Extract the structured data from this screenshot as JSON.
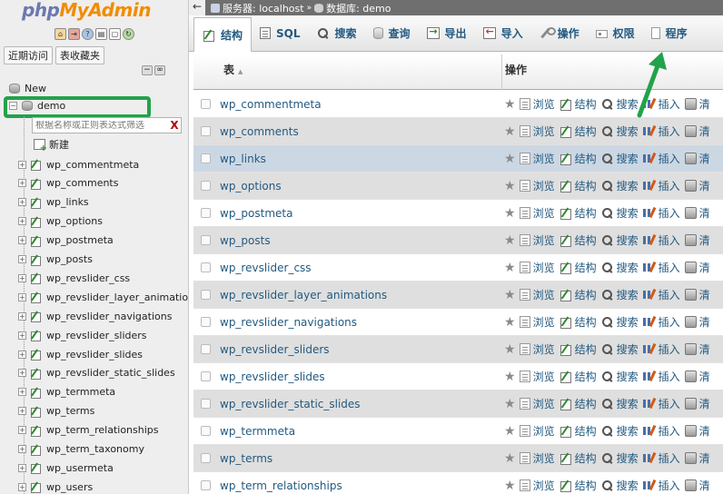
{
  "sidebar": {
    "logo_php": "php",
    "logo_myadmin": "MyAdmin",
    "quick_icons": [
      "home-icon",
      "exit-icon",
      "help-icon",
      "docs-icon",
      "reload-icon"
    ],
    "recent_label": "近期访问",
    "favorites_label": "表收藏夹",
    "new_db_label": "New",
    "db_name": "demo",
    "filter_placeholder": "根据名称或正则表达式筛选",
    "filter_clear": "X",
    "new_table_label": "新建",
    "tables": [
      "wp_commentmeta",
      "wp_comments",
      "wp_links",
      "wp_options",
      "wp_postmeta",
      "wp_posts",
      "wp_revslider_css",
      "wp_revslider_layer_animations",
      "wp_revslider_navigations",
      "wp_revslider_sliders",
      "wp_revslider_slides",
      "wp_revslider_static_slides",
      "wp_termmeta",
      "wp_terms",
      "wp_term_relationships",
      "wp_term_taxonomy",
      "wp_usermeta",
      "wp_users"
    ]
  },
  "breadcrumb": {
    "back": "←",
    "server_label": "服务器: localhost",
    "sep": "»",
    "db_label": "数据库: demo"
  },
  "tabs": [
    {
      "label": "结构",
      "icon": "structure",
      "active": true
    },
    {
      "label": "SQL",
      "icon": "sql"
    },
    {
      "label": "搜索",
      "icon": "search"
    },
    {
      "label": "查询",
      "icon": "query"
    },
    {
      "label": "导出",
      "icon": "export"
    },
    {
      "label": "导入",
      "icon": "import"
    },
    {
      "label": "操作",
      "icon": "ops"
    },
    {
      "label": "权限",
      "icon": "priv"
    },
    {
      "label": "程序",
      "icon": "routine"
    }
  ],
  "table_header": {
    "table": "表",
    "actions": "操作",
    "sort": "▲"
  },
  "actions": {
    "browse": "浏览",
    "structure": "结构",
    "search": "搜索",
    "insert": "插入",
    "empty": "清"
  },
  "rows": [
    "wp_commentmeta",
    "wp_comments",
    "wp_links",
    "wp_options",
    "wp_postmeta",
    "wp_posts",
    "wp_revslider_css",
    "wp_revslider_layer_animations",
    "wp_revslider_navigations",
    "wp_revslider_sliders",
    "wp_revslider_slides",
    "wp_revslider_static_slides",
    "wp_termmeta",
    "wp_terms",
    "wp_term_relationships"
  ],
  "colors": {
    "link": "#235a81",
    "highlight_box": "#22a24a",
    "hover_row": "#ccd7e4"
  }
}
